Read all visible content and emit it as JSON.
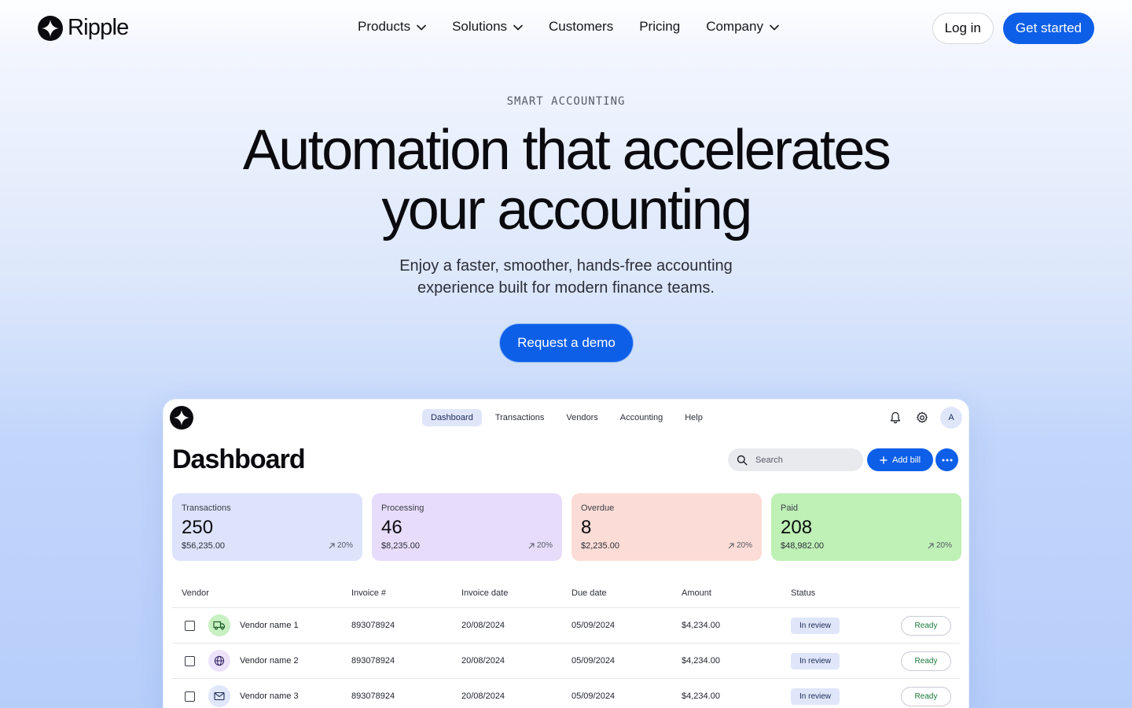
{
  "nav": {
    "brand": "Ripple",
    "links": [
      {
        "label": "Products",
        "dropdown": true
      },
      {
        "label": "Solutions",
        "dropdown": true
      },
      {
        "label": "Customers",
        "dropdown": false
      },
      {
        "label": "Pricing",
        "dropdown": false
      },
      {
        "label": "Company",
        "dropdown": true
      }
    ],
    "login": "Log in",
    "cta": "Get started"
  },
  "hero": {
    "eyebrow": "SMART ACCOUNTING",
    "headline_line1": "Automation that accelerates",
    "headline_line2": "your accounting",
    "subtext_line1": "Enjoy a faster, smoother, hands-free accounting",
    "subtext_line2": "experience built for modern finance teams.",
    "cta": "Request a demo"
  },
  "app": {
    "tabs": [
      "Dashboard",
      "Transactions",
      "Vendors",
      "Accounting",
      "Help"
    ],
    "active_tab": "Dashboard",
    "avatar_initial": "A",
    "title": "Dashboard",
    "search_placeholder": "Search",
    "add_bill": "Add bill",
    "stats": [
      {
        "label": "Transactions",
        "value": "250",
        "amount": "$56,235.00",
        "delta": "20%",
        "color": "#dce3fb"
      },
      {
        "label": "Processing",
        "value": "46",
        "amount": "$8,235.00",
        "delta": "20%",
        "color": "#e8dcfb"
      },
      {
        "label": "Overdue",
        "value": "8",
        "amount": "$2,235.00",
        "delta": "20%",
        "color": "#fcdcd6"
      },
      {
        "label": "Paid",
        "value": "208",
        "amount": "$48,982.00",
        "delta": "20%",
        "color": "#bff0b6"
      }
    ],
    "table": {
      "headers": [
        "Vendor",
        "Invoice #",
        "Invoice date",
        "Due date",
        "Amount",
        "Status"
      ],
      "rows": [
        {
          "vendor": "Vendor name 1",
          "icon": "truck-icon",
          "icon_bg": "#c8f0c2",
          "invoice": "893078924",
          "invoice_date": "20/08/2024",
          "due_date": "05/09/2024",
          "amount": "$4,234.00",
          "status": "In review",
          "action": "Ready"
        },
        {
          "vendor": "Vendor name 2",
          "icon": "globe-icon",
          "icon_bg": "#ece3fb",
          "invoice": "893078924",
          "invoice_date": "20/08/2024",
          "due_date": "05/09/2024",
          "amount": "$4,234.00",
          "status": "In review",
          "action": "Ready"
        },
        {
          "vendor": "Vendor name 3",
          "icon": "mail-icon",
          "icon_bg": "#e0e7fb",
          "invoice": "893078924",
          "invoice_date": "20/08/2024",
          "due_date": "05/09/2024",
          "amount": "$4,234.00",
          "status": "In review",
          "action": "Ready"
        }
      ]
    }
  },
  "colors": {
    "accent": "#0d5fe8",
    "text": "#0b0b0f"
  }
}
